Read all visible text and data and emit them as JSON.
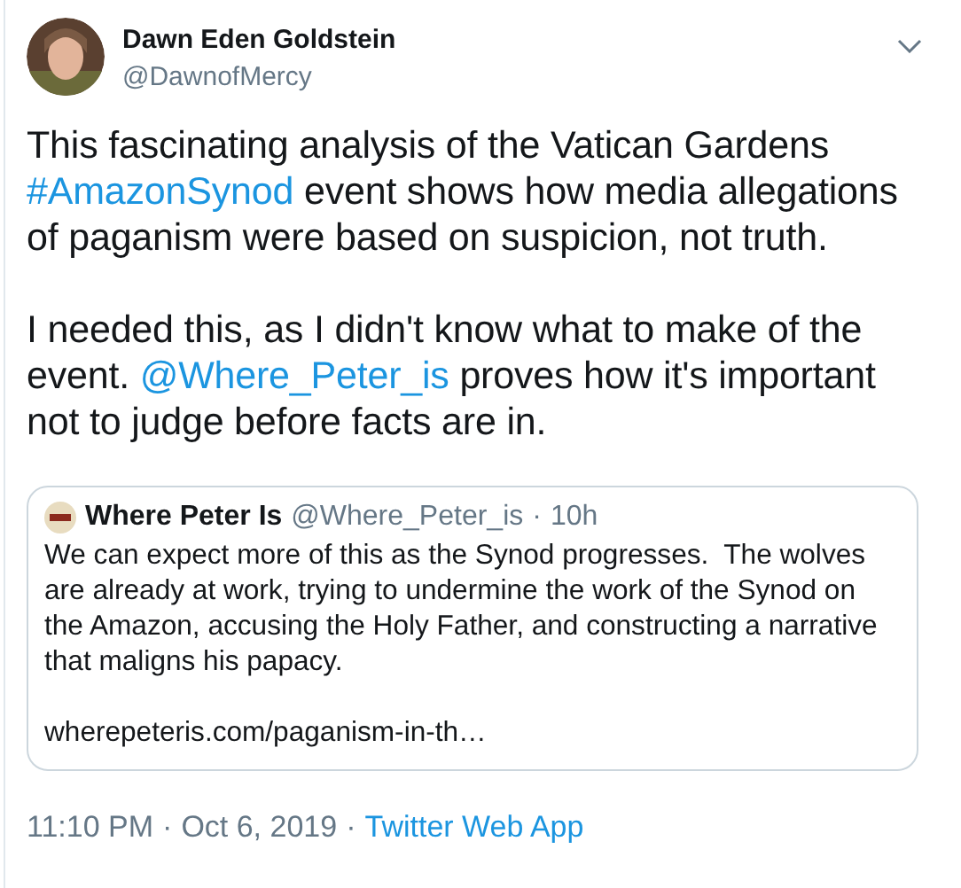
{
  "author": {
    "name": "Dawn Eden Goldstein",
    "handle": "@DawnofMercy"
  },
  "paragraphs": [
    [
      {
        "kind": "text",
        "text": "This fascinating analysis of the Vatican Gardens "
      },
      {
        "kind": "link",
        "text": "#AmazonSynod"
      },
      {
        "kind": "text",
        "text": " event shows how media allegations of paganism were based on suspicion, not truth."
      }
    ],
    [
      {
        "kind": "text",
        "text": "I needed this, as I didn't know what to make of the event. "
      },
      {
        "kind": "link",
        "text": "@Where_Peter_is"
      },
      {
        "kind": "text",
        "text": " proves how it's important not to judge before facts are in."
      }
    ]
  ],
  "quote": {
    "name": "Where Peter Is",
    "handle": "@Where_Peter_is",
    "separator": "·",
    "time": "10h",
    "text": "We can expect more of this as the Synod progresses.  The wolves are already at work, trying to undermine the work of the Synod on the Amazon, accusing the Holy Father, and constructing a narrative that maligns his papacy.",
    "link": "wherepeteris.com/paganism-in-th…"
  },
  "footer": {
    "time": "11:10 PM",
    "separator_1": "·",
    "date": "Oct 6, 2019",
    "separator_2": "·",
    "source": "Twitter Web App"
  }
}
